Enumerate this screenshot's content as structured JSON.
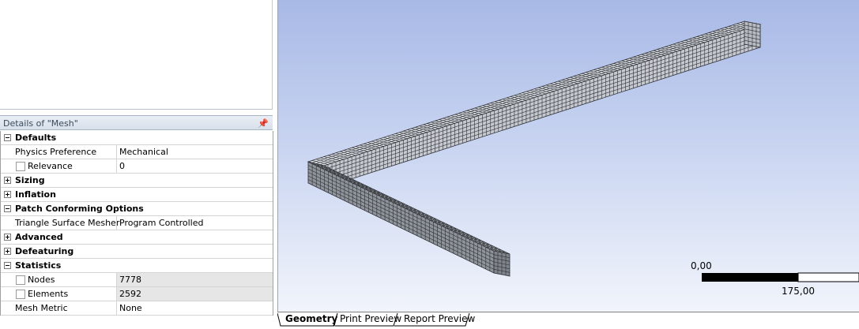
{
  "details": {
    "title": "Details of \"Mesh\"",
    "pin_glyph": "↑",
    "rows": [
      {
        "label": "Defaults",
        "value": "",
        "type": "group",
        "expander": "minus"
      },
      {
        "label": "Physics Preference",
        "value": "Mechanical",
        "type": "prop"
      },
      {
        "label": "Relevance",
        "value": "0",
        "type": "prop-check"
      },
      {
        "label": "Sizing",
        "value": "",
        "type": "group",
        "expander": "plus"
      },
      {
        "label": "Inflation",
        "value": "",
        "type": "group",
        "expander": "plus"
      },
      {
        "label": "Patch Conforming Options",
        "value": "",
        "type": "group",
        "expander": "minus"
      },
      {
        "label": "Triangle Surface Mesher",
        "value": "Program Controlled",
        "type": "prop"
      },
      {
        "label": "Advanced",
        "value": "",
        "type": "group",
        "expander": "plus"
      },
      {
        "label": "Defeaturing",
        "value": "",
        "type": "group",
        "expander": "plus"
      },
      {
        "label": "Statistics",
        "value": "",
        "type": "group",
        "expander": "minus"
      },
      {
        "label": "Nodes",
        "value": "7778",
        "type": "prop-check",
        "gray": true
      },
      {
        "label": "Elements",
        "value": "2592",
        "type": "prop-check",
        "gray": true
      },
      {
        "label": "Mesh Metric",
        "value": "None",
        "type": "prop"
      }
    ]
  },
  "viewport": {
    "scale_start": "0,00",
    "scale_end": "175,00",
    "background_top": "#a8b9e6",
    "background_bottom": "#f1f4fb",
    "mesh_face_color": "#d9dde2",
    "mesh_side_color": "#8f949b"
  },
  "tabs": [
    {
      "label": "Geometry",
      "active": true
    },
    {
      "label": "Print Preview",
      "active": false
    },
    {
      "label": "Report Preview",
      "active": false
    }
  ]
}
